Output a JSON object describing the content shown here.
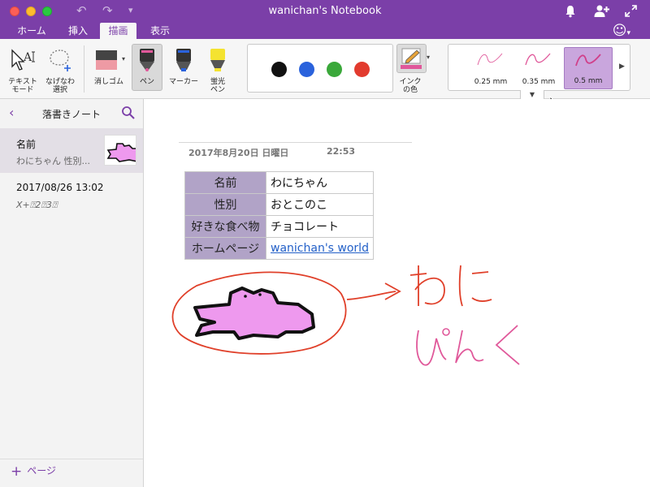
{
  "window": {
    "title": "wanichan's Notebook"
  },
  "tabs": [
    {
      "label": "ホーム"
    },
    {
      "label": "挿入"
    },
    {
      "label": "描画"
    },
    {
      "label": "表示"
    }
  ],
  "ribbon": {
    "text_mode": "テキスト\nモード",
    "lasso": "なげなわ\n選択",
    "eraser": "消しゴム",
    "pen": "ペン",
    "marker": "マーカー",
    "highlighter": "蛍光\nペン",
    "ink_color": "インク\nの色",
    "colors": [
      "#111111",
      "#2a62dc",
      "#3aa83a",
      "#e23b2e"
    ],
    "thickness": [
      {
        "label": "0.25 mm"
      },
      {
        "label": "0.35 mm"
      },
      {
        "label": "0.5 mm"
      }
    ]
  },
  "sidebar": {
    "title": "落書きノート",
    "pages": [
      {
        "title": "名前",
        "preview": "わにちゃん  性別..."
      },
      {
        "title": "2017/08/26 13:02",
        "preview": "X+⍰2⍰3⍰"
      }
    ],
    "add_page": "ページ"
  },
  "note": {
    "date": "2017年8月20日 日曜日",
    "time": "22:53",
    "table": [
      {
        "key": "名前",
        "value": "わにちゃん"
      },
      {
        "key": "性別",
        "value": "おとこのこ"
      },
      {
        "key": "好きな食べ物",
        "value": "チョコレート"
      },
      {
        "key": "ホームページ",
        "value": "wanichan's world"
      }
    ],
    "colors": {
      "accent": "#7b3fa8",
      "pink": "#ee99ee",
      "red_ink": "#e0402a",
      "pink_ink": "#e0589a"
    }
  }
}
